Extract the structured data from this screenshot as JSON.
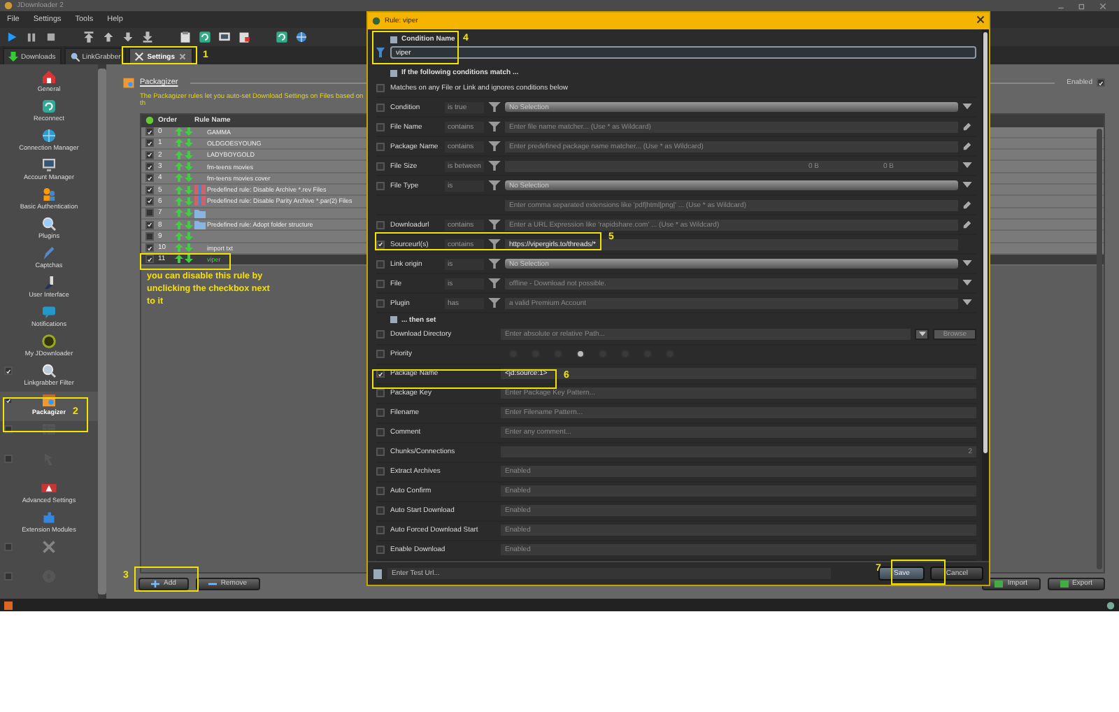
{
  "window": {
    "title": "JDownloader 2"
  },
  "menu": [
    "File",
    "Settings",
    "Tools",
    "Help"
  ],
  "tabs": [
    {
      "label": "Downloads",
      "selected": false,
      "closable": false
    },
    {
      "label": "LinkGrabber",
      "selected": false,
      "closable": false
    },
    {
      "label": "Settings",
      "selected": true,
      "closable": true
    }
  ],
  "sidebar": {
    "items": [
      {
        "kind": "section",
        "label": "General",
        "selected": false
      },
      {
        "kind": "section",
        "label": "Reconnect",
        "selected": false
      },
      {
        "kind": "section",
        "label": "Connection Manager",
        "selected": false
      },
      {
        "kind": "section",
        "label": "Account Manager",
        "selected": false
      },
      {
        "kind": "section",
        "label": "Basic Authentication",
        "selected": false
      },
      {
        "kind": "section",
        "label": "Plugins",
        "selected": false
      },
      {
        "kind": "section",
        "label": "Captchas",
        "selected": false
      },
      {
        "kind": "section",
        "label": "User Interface",
        "selected": false
      },
      {
        "kind": "section",
        "label": "Notifications",
        "selected": false
      },
      {
        "kind": "section",
        "label": "My JDownloader",
        "selected": false
      },
      {
        "kind": "extension",
        "label": "Linkgrabber Filter",
        "checked": true,
        "selected": false
      },
      {
        "kind": "extension",
        "label": "Packagizer",
        "checked": true,
        "selected": true
      },
      {
        "kind": "extension",
        "checked": false,
        "selected": false
      },
      {
        "kind": "extension",
        "checked": false,
        "selected": false
      },
      {
        "kind": "section",
        "label": "Advanced Settings",
        "selected": false
      },
      {
        "kind": "section",
        "label": "Extension Modules",
        "selected": false
      },
      {
        "kind": "extension",
        "checked": false,
        "selected": false
      },
      {
        "kind": "extension",
        "checked": false,
        "selected": false
      }
    ]
  },
  "packagizer": {
    "title": "Packagizer",
    "enabled_label": "Enabled",
    "enabled": true,
    "description": "The Packagizer rules let you auto-set Download Settings on Files based on th",
    "columns": [
      "Order",
      "Rule Name"
    ],
    "rows": [
      {
        "checked": true,
        "order": "0",
        "kind": "plain",
        "name": "GAMMA",
        "selected": false
      },
      {
        "checked": true,
        "order": "1",
        "kind": "plain",
        "name": "OLDGOESYOUNG",
        "selected": false
      },
      {
        "checked": true,
        "order": "2",
        "kind": "plain",
        "name": "LADYBOYGOLD",
        "selected": false
      },
      {
        "checked": true,
        "order": "3",
        "kind": "plain",
        "name": "fm-teens movies",
        "selected": false
      },
      {
        "checked": true,
        "order": "4",
        "kind": "plain",
        "name": "fm-teens movies cover",
        "selected": false
      },
      {
        "checked": true,
        "order": "5",
        "kind": "archive",
        "name": "Predefined rule: Disable Archive *.rev Files",
        "selected": false
      },
      {
        "checked": true,
        "order": "6",
        "kind": "archive",
        "name": "Predefined rule: Disable Parity Archive *.par(2) Files",
        "selected": false
      },
      {
        "checked": false,
        "order": "7",
        "kind": "folder",
        "selected": false
      },
      {
        "checked": true,
        "order": "8",
        "kind": "folder",
        "name": "Predefined rule: Adopt folder structure",
        "selected": false
      },
      {
        "checked": false,
        "order": "9",
        "kind": "plain",
        "selected": false
      },
      {
        "checked": true,
        "order": "10",
        "kind": "plain",
        "name": "import txt",
        "selected": false
      },
      {
        "checked": true,
        "order": "11",
        "kind": "plain",
        "name": "viper",
        "selected": true
      }
    ],
    "buttons": [
      "Add",
      "Remove"
    ],
    "io_buttons": [
      "Import",
      "Export"
    ]
  },
  "dialog": {
    "title": "Rule: viper",
    "name_label": "Condition Name",
    "name_value": "viper",
    "conditions_label": "If the following conditions match ...",
    "conditions": [
      {
        "kind": "check",
        "label": "Matches on any File or Link and ignores conditions below",
        "checked": false
      },
      {
        "kind": "bar",
        "label": "Condition",
        "checked": false,
        "operator": "is true",
        "value": "No Selection"
      },
      {
        "kind": "text",
        "label": "File Name",
        "checked": false,
        "operator": "contains",
        "placeholder": "Enter file name matcher... (Use * as Wildcard)"
      },
      {
        "kind": "text",
        "label": "Package Name",
        "checked": false,
        "operator": "contains",
        "placeholder": "Enter predefined package name matcher... (Use * as Wildcard)"
      },
      {
        "kind": "size",
        "label": "File Size",
        "checked": false,
        "operator": "is between",
        "values": [
          "0 B",
          "0 B"
        ]
      },
      {
        "kind": "filetype",
        "label": "File Type",
        "checked": false,
        "operator": "is",
        "value": "No Selection",
        "placeholder": "Enter comma separated extensions like 'pdf|html|png|' ... (Use * as Wildcard)"
      },
      {
        "kind": "text",
        "label": "Downloadurl",
        "checked": false,
        "operator": "contains",
        "placeholder": "Enter a URL Expression like 'rapidshare.com' ... (Use * as Wildcard)"
      },
      {
        "kind": "text",
        "label": "Sourceurl(s)",
        "checked": true,
        "operator": "contains",
        "value": "https://vipergirls.to/threads/*"
      },
      {
        "kind": "bar",
        "label": "Link origin",
        "checked": false,
        "operator": "is",
        "value": "No Selection"
      },
      {
        "kind": "combo",
        "label": "File",
        "checked": false,
        "operator": "is",
        "value": "offline - Download not possible."
      },
      {
        "kind": "combo",
        "label": "Plugin",
        "checked": false,
        "operator": "has",
        "value": "a valid Premium Account"
      }
    ],
    "actions_label": "... then set",
    "actions": [
      {
        "kind": "path",
        "label": "Download Directory",
        "checked": false,
        "placeholder": "Enter absolute or relative Path...",
        "browse": "Browse"
      },
      {
        "kind": "priority",
        "label": "Priority",
        "checked": false,
        "options": [
          {
            "selected": false
          },
          {
            "selected": false
          },
          {
            "selected": false
          },
          {
            "selected": true
          },
          {
            "selected": false
          },
          {
            "selected": false
          },
          {
            "selected": false
          },
          {
            "selected": false
          }
        ]
      },
      {
        "kind": "text",
        "label": "Package Name",
        "checked": true,
        "value": "<jd:source:1>"
      },
      {
        "kind": "text",
        "label": "Package Key",
        "checked": false,
        "placeholder": "Enter Package Key Pattern..."
      },
      {
        "kind": "text",
        "label": "Filename",
        "checked": false,
        "placeholder": "Enter Filename Pattern..."
      },
      {
        "kind": "text",
        "label": "Comment",
        "checked": false,
        "placeholder": "Enter any comment..."
      },
      {
        "kind": "spinner",
        "label": "Chunks/Connections",
        "checked": false,
        "value": "2"
      },
      {
        "kind": "combo",
        "label": "Extract Archives",
        "checked": false,
        "value": "Enabled"
      },
      {
        "kind": "combo",
        "label": "Auto Confirm",
        "checked": false,
        "value": "Enabled"
      },
      {
        "kind": "combo",
        "label": "Auto Start Download",
        "checked": false,
        "value": "Enabled"
      },
      {
        "kind": "combo",
        "label": "Auto Forced Download Start",
        "checked": false,
        "value": "Enabled"
      },
      {
        "kind": "combo",
        "label": "Enable Download",
        "checked": false,
        "value": "Enabled"
      }
    ],
    "test_placeholder": "Enter Test Url...",
    "buttons": [
      {
        "label": "Save",
        "default": true
      },
      {
        "label": "Cancel",
        "default": false
      }
    ]
  },
  "annotations": [
    {
      "kind": "numbered",
      "number": "1"
    },
    {
      "kind": "numbered",
      "number": "2"
    },
    {
      "kind": "numbered",
      "number": "3"
    },
    {
      "kind": "numbered",
      "number": "4"
    },
    {
      "kind": "numbered",
      "number": "5"
    },
    {
      "kind": "numbered",
      "number": "6"
    },
    {
      "kind": "numbered",
      "number": "7"
    },
    {
      "kind": "box"
    }
  ],
  "note": "you can disable this rule by unclicking the checkbox next to it"
}
